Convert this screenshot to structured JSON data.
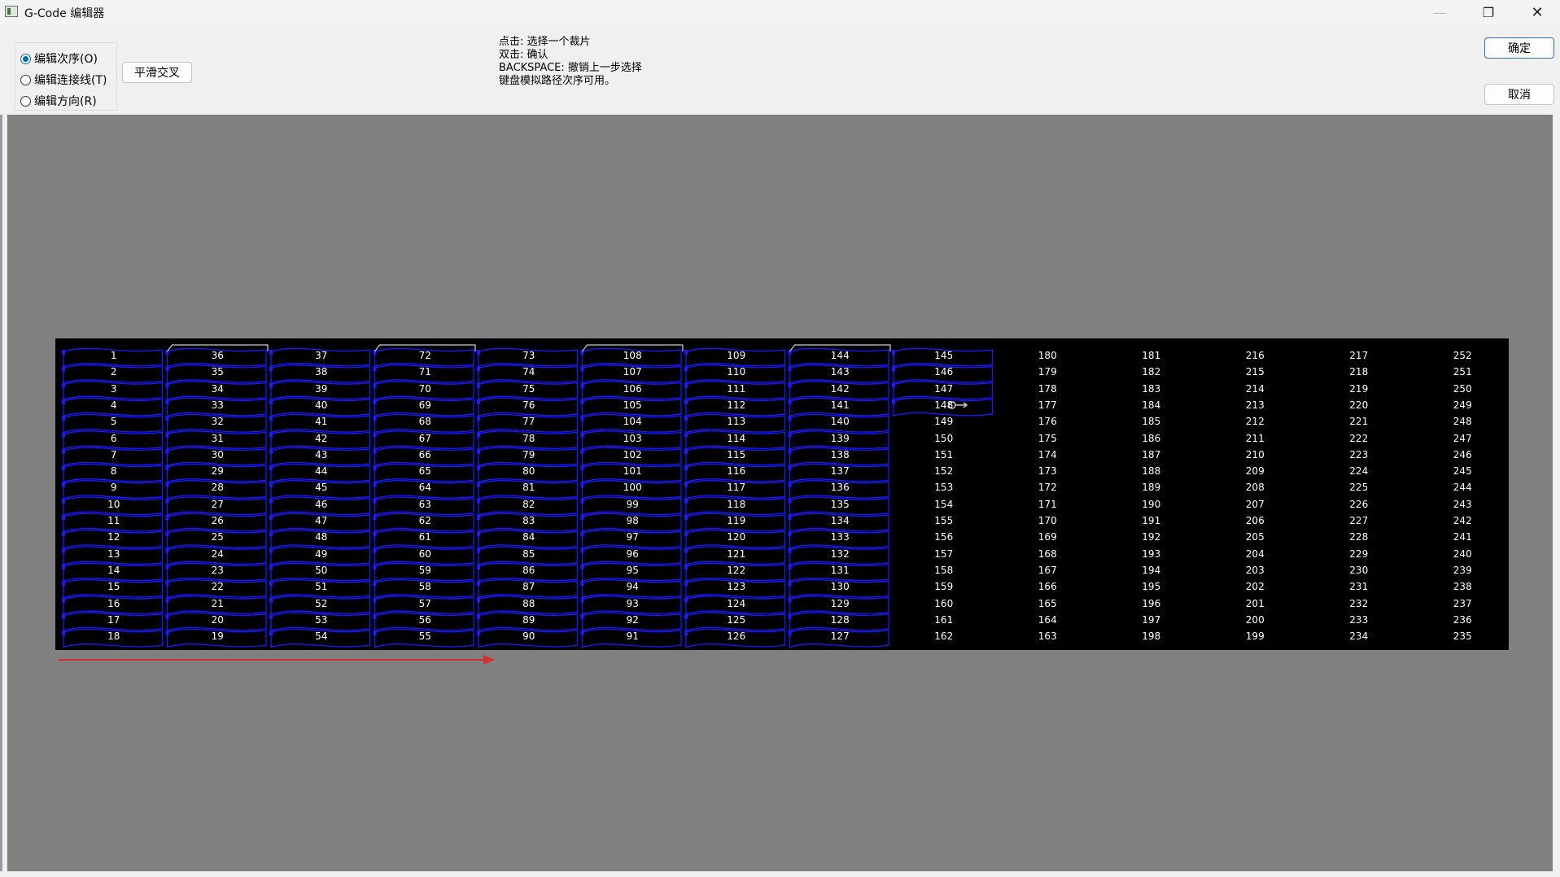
{
  "window": {
    "title": "G-Code 编辑器",
    "minimize_glyph": "—",
    "maximize_glyph": "❐",
    "close_glyph": "✕"
  },
  "mode_options": [
    {
      "label": "编辑次序(O)",
      "checked": true
    },
    {
      "label": "编辑连接线(T)",
      "checked": false
    },
    {
      "label": "编辑方向(R)",
      "checked": false
    }
  ],
  "buttons": {
    "smooth_cross": "平滑交叉",
    "ok": "确定",
    "cancel": "取消"
  },
  "help_lines": [
    "点击: 选择一个裁片",
    "双击: 确认",
    "BACKSPACE: 撤销上一步选择",
    "键盘模拟路径次序可用。"
  ],
  "colors": {
    "canvas_bg": "#808080",
    "board_bg": "#000000",
    "piece_outline": "#1a1aff",
    "label": "#ffffff",
    "arrow": "#d03030"
  },
  "grid": {
    "columns": [
      [
        1,
        2,
        3,
        4,
        5,
        6,
        7,
        8,
        9,
        10,
        11,
        12,
        13,
        14,
        15,
        16,
        17,
        18
      ],
      [
        36,
        35,
        34,
        33,
        32,
        31,
        30,
        29,
        28,
        27,
        26,
        25,
        24,
        23,
        22,
        21,
        20,
        19
      ],
      [
        37,
        38,
        39,
        40,
        41,
        42,
        43,
        44,
        45,
        46,
        47,
        48,
        49,
        50,
        51,
        52,
        53,
        54
      ],
      [
        72,
        71,
        70,
        69,
        68,
        67,
        66,
        65,
        64,
        63,
        62,
        61,
        60,
        59,
        58,
        57,
        56,
        55
      ],
      [
        73,
        74,
        75,
        76,
        77,
        78,
        79,
        80,
        81,
        82,
        83,
        84,
        85,
        86,
        87,
        88,
        89,
        90
      ],
      [
        108,
        107,
        106,
        105,
        104,
        103,
        102,
        101,
        100,
        99,
        98,
        97,
        96,
        95,
        94,
        93,
        92,
        91
      ],
      [
        109,
        110,
        111,
        112,
        113,
        114,
        115,
        116,
        117,
        118,
        119,
        120,
        121,
        122,
        123,
        124,
        125,
        126
      ],
      [
        144,
        143,
        142,
        141,
        140,
        139,
        138,
        137,
        136,
        135,
        134,
        133,
        132,
        131,
        130,
        129,
        128,
        127
      ],
      [
        145,
        146,
        147,
        148,
        149,
        150,
        151,
        152,
        153,
        154,
        155,
        156,
        157,
        158,
        159,
        160,
        161,
        162
      ],
      [
        180,
        179,
        178,
        177,
        176,
        175,
        174,
        173,
        172,
        171,
        170,
        169,
        168,
        167,
        166,
        165,
        164,
        163
      ],
      [
        181,
        182,
        183,
        184,
        185,
        186,
        187,
        188,
        189,
        190,
        191,
        192,
        193,
        194,
        195,
        196,
        197,
        198
      ],
      [
        216,
        215,
        214,
        213,
        212,
        211,
        210,
        209,
        208,
        207,
        206,
        205,
        204,
        203,
        202,
        201,
        200,
        199
      ],
      [
        217,
        218,
        219,
        220,
        221,
        222,
        223,
        224,
        225,
        226,
        227,
        228,
        229,
        230,
        231,
        232,
        233,
        234
      ],
      [
        252,
        251,
        250,
        249,
        248,
        247,
        246,
        245,
        244,
        243,
        242,
        241,
        240,
        239,
        238,
        237,
        236,
        235
      ]
    ],
    "outlined_full_columns": 8,
    "outlined_partial_rows_col9": 4
  }
}
